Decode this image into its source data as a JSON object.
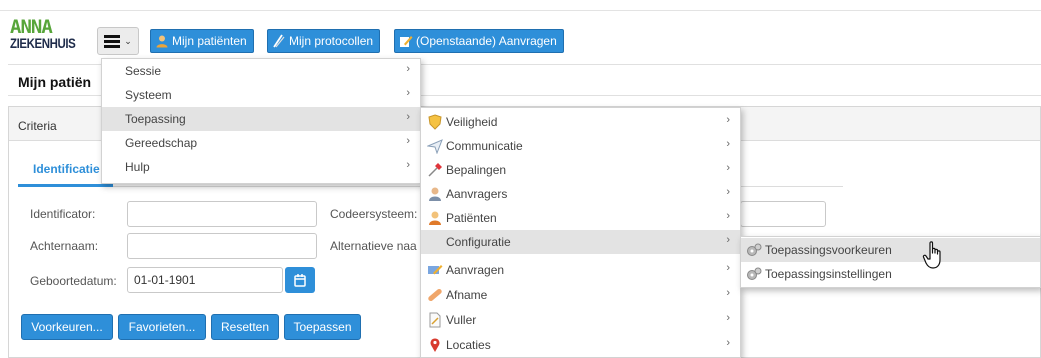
{
  "logo": {
    "line1": "ANNA",
    "line2": "ZIEKENHUIS"
  },
  "toolbar": {
    "menu_label": "menu",
    "buttons": [
      {
        "label": "Mijn patiënten",
        "icon": "user-icon"
      },
      {
        "label": "Mijn protocollen",
        "icon": "protocol-icon"
      },
      {
        "label": "(Openstaande) Aanvragen",
        "icon": "pencil-icon"
      }
    ]
  },
  "page": {
    "title": "Mijn patiën"
  },
  "criteria": {
    "title": "Criteria",
    "tab": "Identificatie",
    "fields": {
      "identificator": "Identificator:",
      "codeersysteem": "Codeersysteem:",
      "achternaam": "Achternaam:",
      "alternatieve": "Alternatieve naa",
      "geboortedatum": "Geboortedatum:",
      "geboortedatum_value": "01-01-1901"
    },
    "buttons": {
      "voorkeuren": "Voorkeuren...",
      "favorieten": "Favorieten...",
      "resetten": "Resetten",
      "toepassen": "Toepassen"
    }
  },
  "menu_main": [
    "Sessie",
    "Systeem",
    "Toepassing",
    "Gereedschap",
    "Hulp"
  ],
  "menu_toepassing": [
    {
      "label": "Veiligheid",
      "icon": "shield-icon"
    },
    {
      "label": "Communicatie",
      "icon": "paper-plane-icon"
    },
    {
      "label": "Bepalingen",
      "icon": "syringe-icon"
    },
    {
      "label": "Aanvragers",
      "icon": "doctor-icon"
    },
    {
      "label": "Patiënten",
      "icon": "patient-icon"
    },
    {
      "label": "Configuratie",
      "icon": ""
    },
    {
      "label": "Aanvragen",
      "icon": "form-pencil-icon"
    },
    {
      "label": "Afname",
      "icon": "bandage-icon"
    },
    {
      "label": "Vuller",
      "icon": "document-icon"
    },
    {
      "label": "Locaties",
      "icon": "location-pin-icon"
    }
  ],
  "menu_configuratie": [
    {
      "label": "Toepassingsvoorkeuren",
      "icon": "gears-icon"
    },
    {
      "label": "Toepassingsinstellingen",
      "icon": "gears-icon"
    }
  ],
  "colors": {
    "accent": "#2e8fd9",
    "highlight": "#e3e3e3",
    "logo_green": "#57a53a",
    "logo_navy": "#1e2b4a"
  }
}
